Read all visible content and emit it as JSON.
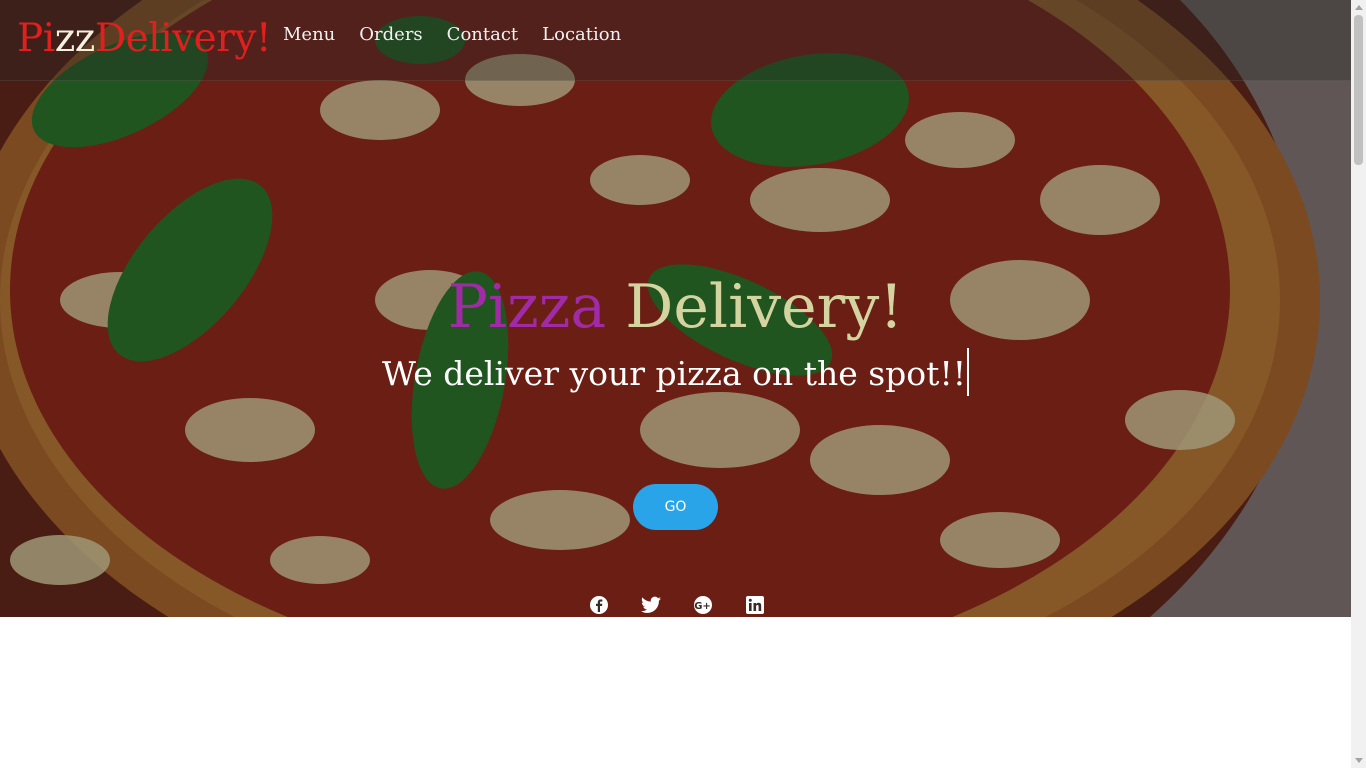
{
  "brand": {
    "part1": "Pi",
    "part2": "zz",
    "part3": "Delivery!"
  },
  "nav": {
    "items": [
      "Menu",
      "Orders",
      "Contact",
      "Location"
    ]
  },
  "hero": {
    "headline_word1": "Pizza",
    "headline_word2": "Delivery!",
    "tagline": "We deliver your pizza on the spot!!",
    "button_label": "GO"
  },
  "social_icons": [
    "facebook-icon",
    "twitter-icon",
    "google-plus-icon",
    "linkedin-icon"
  ],
  "colors": {
    "brand_red": "#e0201e",
    "brand_light": "#f3f0de",
    "headline_purple": "#a12aa6",
    "headline_cream": "#d4d4a0",
    "button_blue": "#2aa4e8"
  }
}
